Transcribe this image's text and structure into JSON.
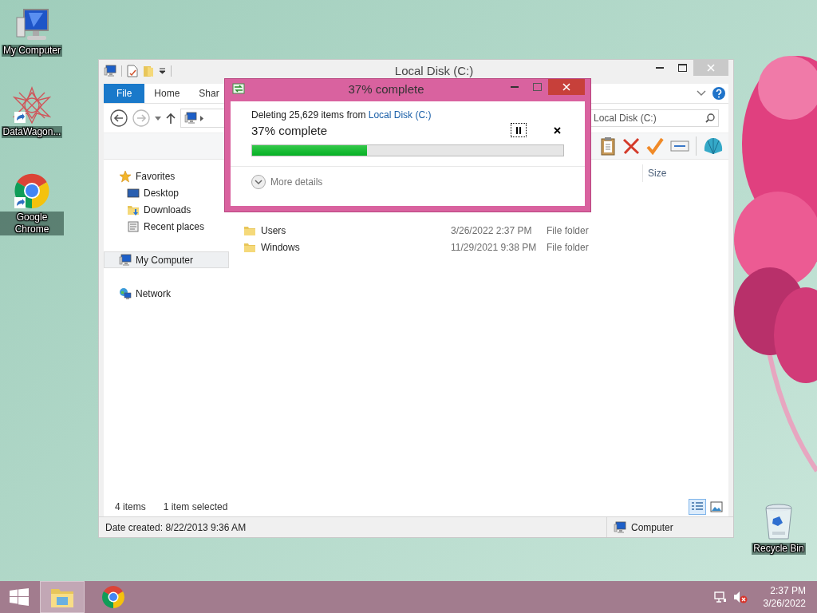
{
  "desktop_icons": [
    {
      "label": "My Computer",
      "kind": "computer"
    },
    {
      "label": "DataWagon...",
      "kind": "mandala"
    },
    {
      "label": "Google Chrome",
      "kind": "browser"
    },
    {
      "label": "Recycle Bin",
      "kind": "bin"
    }
  ],
  "explorer": {
    "title": "Local Disk (C:)",
    "ribbon_tabs": [
      {
        "label": "File",
        "selected": true
      },
      {
        "label": "Home",
        "selected": false
      },
      {
        "label": "Shar",
        "selected": false
      }
    ],
    "search": {
      "placeholder": "Local Disk (C:)"
    },
    "columns": [
      "Size"
    ],
    "nav": [
      {
        "label": "Favorites",
        "kind": "star",
        "selected": false,
        "children": [
          {
            "label": "Desktop",
            "kind": "desktop",
            "selected": false
          },
          {
            "label": "Downloads",
            "kind": "downloads",
            "selected": false
          },
          {
            "label": "Recent places",
            "kind": "recent",
            "selected": false
          }
        ]
      },
      {
        "label": "My Computer",
        "kind": "computer",
        "selected": true
      },
      {
        "label": "Network",
        "kind": "network",
        "selected": false
      }
    ],
    "files": [
      {
        "name": "Users",
        "date": "3/26/2022 2:37 PM",
        "type": "File folder"
      },
      {
        "name": "Windows",
        "date": "11/29/2021 9:38 PM",
        "type": "File folder"
      }
    ],
    "status": {
      "count": "4 items",
      "selection": "1 item selected"
    },
    "views": [
      {
        "kind": "details",
        "selected": true
      },
      {
        "kind": "icons",
        "selected": false
      }
    ],
    "details_bar": {
      "text": "Date created: 8/22/2013 9:36 AM",
      "location": "Computer"
    }
  },
  "dialog": {
    "title": "37% complete",
    "message": "Deleting 25,629 items from ",
    "link": "Local Disk (C:)",
    "status": "37% complete",
    "level": 0.37,
    "more": "More details"
  },
  "taskbar": {
    "apps": [
      {
        "kind": "explorer",
        "selected": true
      },
      {
        "kind": "browser",
        "selected": false
      }
    ],
    "time": "2:37 PM",
    "date": "3/26/2022"
  }
}
